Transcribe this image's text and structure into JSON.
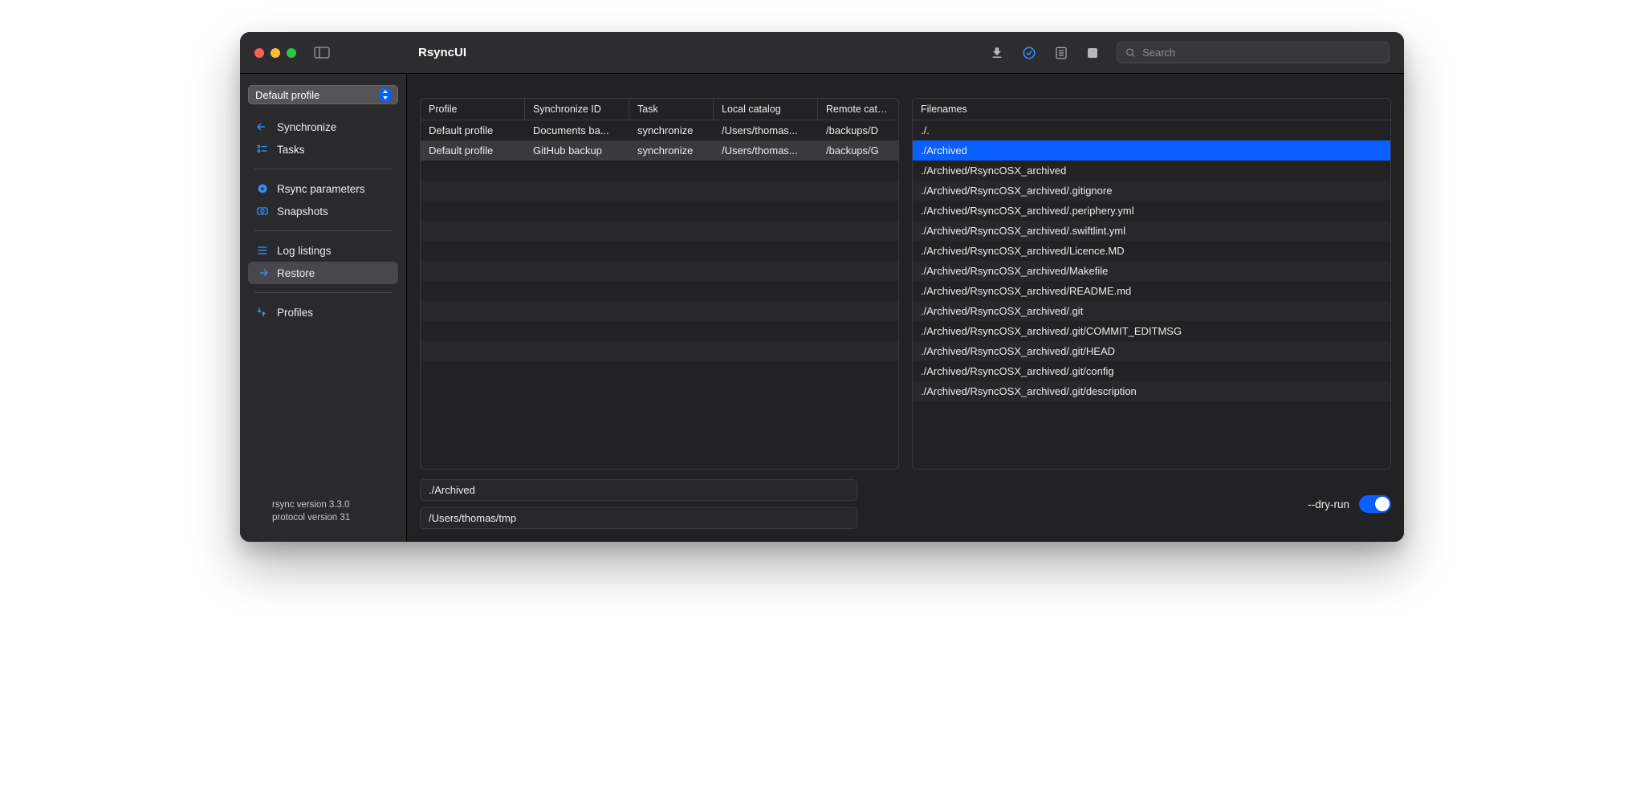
{
  "app_title": "RsyncUI",
  "search_placeholder": "Search",
  "profile_selector": "Default profile",
  "sidebar": {
    "items": [
      {
        "label": "Synchronize"
      },
      {
        "label": "Tasks"
      },
      {
        "label": "Rsync parameters"
      },
      {
        "label": "Snapshots"
      },
      {
        "label": "Log listings"
      },
      {
        "label": "Restore"
      },
      {
        "label": "Profiles"
      }
    ],
    "footer_line1": "rsync  version 3.3.0",
    "footer_line2": "protocol version 31"
  },
  "table": {
    "headers": {
      "profile": "Profile",
      "sync_id": "Synchronize ID",
      "task": "Task",
      "local": "Local catalog",
      "remote": "Remote catalog"
    },
    "rows": [
      {
        "profile": "Default profile",
        "sync_id": "Documents ba...",
        "task": "synchronize",
        "local": "/Users/thomas...",
        "remote": "/backups/D"
      },
      {
        "profile": "Default profile",
        "sync_id": "GitHub backup",
        "task": "synchronize",
        "local": "/Users/thomas...",
        "remote": "/backups/G"
      }
    ]
  },
  "files": {
    "header": "Filenames",
    "rows": [
      "./.",
      "./Archived",
      "./Archived/RsyncOSX_archived",
      "./Archived/RsyncOSX_archived/.gitignore",
      "./Archived/RsyncOSX_archived/.periphery.yml",
      "./Archived/RsyncOSX_archived/.swiftlint.yml",
      "./Archived/RsyncOSX_archived/Licence.MD",
      "./Archived/RsyncOSX_archived/Makefile",
      "./Archived/RsyncOSX_archived/README.md",
      "./Archived/RsyncOSX_archived/.git",
      "./Archived/RsyncOSX_archived/.git/COMMIT_EDITMSG",
      "./Archived/RsyncOSX_archived/.git/HEAD",
      "./Archived/RsyncOSX_archived/.git/config",
      "./Archived/RsyncOSX_archived/.git/description"
    ],
    "selected_index": 1
  },
  "inputs": {
    "source": "./Archived",
    "dest": "/Users/thomas/tmp"
  },
  "dry_run_label": "--dry-run"
}
